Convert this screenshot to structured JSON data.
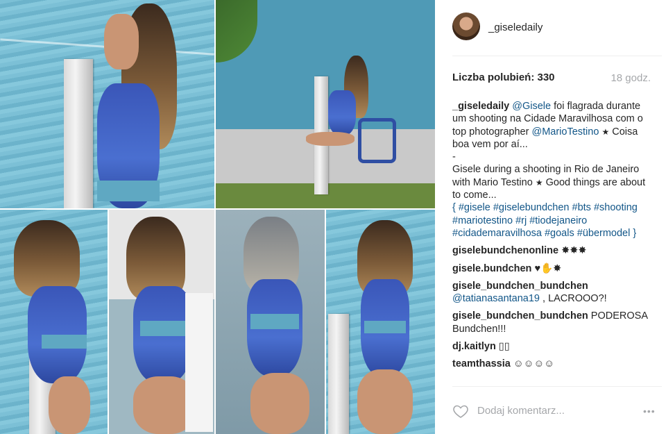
{
  "post": {
    "username": "_giseledaily",
    "likes_text": "Liczba polubień: 330",
    "time_ago": "18 godz."
  },
  "caption": {
    "username": "_giseledaily",
    "mention": "@Gisele",
    "line1": " foi flagrada durante um shooting na Cidade Maravilhosa com o top photographer ",
    "mention2": "@MarioTestino",
    "line2": " Coisa boa vem por aí...",
    "dash": "-",
    "line3": "Gisele during a shooting in Rio de Janeiro with Mario Testino ",
    "line4": " Good things are about to come...",
    "hashtags": "{ #gisele #giselebundchen #bts #shooting #mariotestino #rj #tiodejaneiro #cidademaravilhosa #goals #übermodel }"
  },
  "comments": [
    {
      "user": "giselebundchenonline",
      "text": " ✸✸✸"
    },
    {
      "user": "gisele.bundchen",
      "text": " ♥✋✸"
    },
    {
      "user": "gisele_bundchen_bundchen",
      "mention": "@tatianasantana19",
      "text": " , LACROOO?!"
    },
    {
      "user": "gisele_bundchen_bundchen",
      "text": " PODEROSA Bundchen!!!"
    },
    {
      "user": "dj.kaitlyn",
      "text": " ▯▯"
    },
    {
      "user": "teamthassia",
      "text": " ☺☺☺☺"
    }
  ],
  "footer": {
    "add_comment_placeholder": "Dodaj komentarz...",
    "more_label": "•••"
  },
  "colors": {
    "link": "#125688",
    "muted": "#a5a7aa",
    "text": "#262626"
  }
}
